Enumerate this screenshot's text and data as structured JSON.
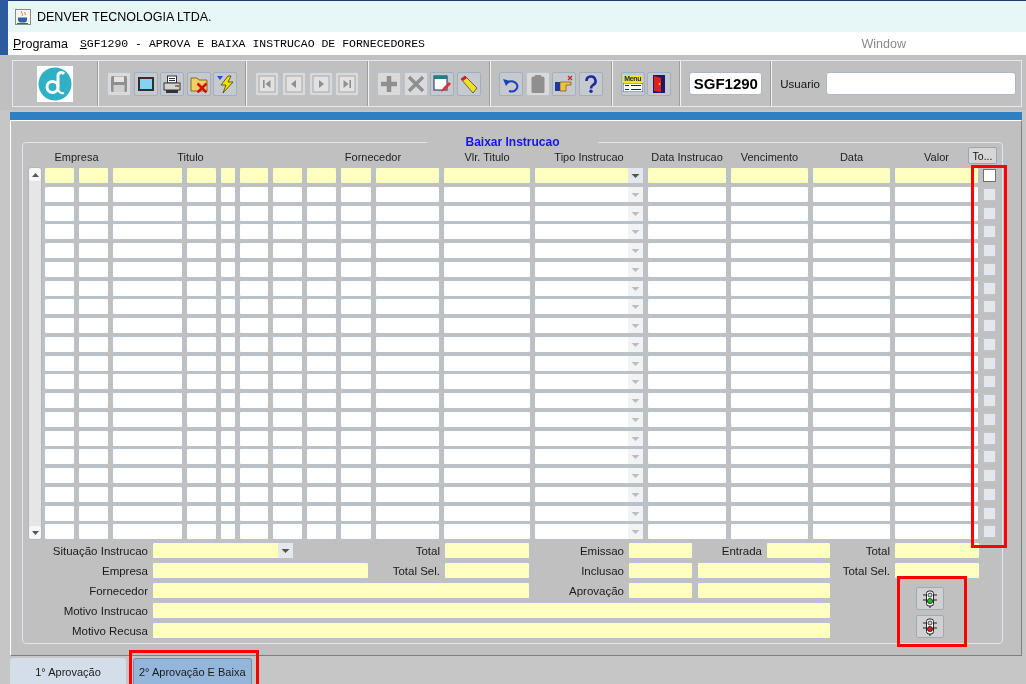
{
  "window": {
    "title": "DENVER TECNOLOGIA LTDA."
  },
  "menu_bar": [
    {
      "label": "Programa",
      "kind": "menu",
      "disabled": false
    },
    {
      "label": "SGF1290 - APROVA E BAIXA INSTRUCAO DE FORNECEDORES",
      "kind": "program",
      "disabled": false
    },
    {
      "label": "Window",
      "kind": "window",
      "disabled": true
    }
  ],
  "toolbar": {
    "groups": [
      {
        "buttons": [
          {
            "kind": "save",
            "disabled": true
          },
          {
            "kind": "screen",
            "disabled": false
          },
          {
            "kind": "print",
            "disabled": false
          },
          {
            "kind": "clear",
            "disabled": false
          },
          {
            "kind": "execute",
            "disabled": false
          }
        ]
      },
      {
        "buttons": [
          {
            "kind": "first",
            "disabled": true
          },
          {
            "kind": "previous",
            "disabled": true
          },
          {
            "kind": "next",
            "disabled": true
          },
          {
            "kind": "last",
            "disabled": true
          }
        ]
      },
      {
        "buttons": [
          {
            "kind": "add",
            "disabled": true
          },
          {
            "kind": "remove",
            "disabled": true
          },
          {
            "kind": "edit",
            "disabled": false
          },
          {
            "kind": "marker",
            "disabled": false
          }
        ]
      },
      {
        "buttons": [
          {
            "kind": "undo",
            "disabled": false
          },
          {
            "kind": "clipboard",
            "disabled": true
          },
          {
            "kind": "hand",
            "disabled": false
          },
          {
            "kind": "help",
            "disabled": false
          }
        ]
      },
      {
        "buttons": [
          {
            "kind": "menu",
            "label": "Menu",
            "disabled": false
          },
          {
            "kind": "exit",
            "disabled": false
          }
        ]
      }
    ],
    "program_code": "SGF1290",
    "user_label": "Usuario"
  },
  "table": {
    "title": "Baixar Instrucao",
    "columns": [
      "Empresa",
      "Titulo",
      "Fornecedor",
      "Vlr. Titulo",
      "Tipo Instrucao",
      "Data Instrucao",
      "Vencimento",
      "Data",
      "Valor"
    ],
    "header_button": "To...",
    "rows": [
      {
        "selected": true,
        "checked": false
      },
      {
        "selected": false,
        "checked": false
      },
      {
        "selected": false,
        "checked": false
      },
      {
        "selected": false,
        "checked": false
      },
      {
        "selected": false,
        "checked": false
      },
      {
        "selected": false,
        "checked": false
      },
      {
        "selected": false,
        "checked": false
      },
      {
        "selected": false,
        "checked": false
      },
      {
        "selected": false,
        "checked": false
      },
      {
        "selected": false,
        "checked": false
      },
      {
        "selected": false,
        "checked": false
      },
      {
        "selected": false,
        "checked": false
      },
      {
        "selected": false,
        "checked": false
      },
      {
        "selected": false,
        "checked": false
      },
      {
        "selected": false,
        "checked": false
      },
      {
        "selected": false,
        "checked": false
      },
      {
        "selected": false,
        "checked": false
      },
      {
        "selected": false,
        "checked": false
      },
      {
        "selected": false,
        "checked": false
      },
      {
        "selected": false,
        "checked": false
      }
    ]
  },
  "form": {
    "rows": [
      {
        "items": [
          {
            "label": "Situação Instrucao",
            "kind": "dropdown"
          },
          {
            "label": "Total",
            "kind": "text"
          },
          {
            "label": "Emissao",
            "kind": "text"
          },
          {
            "label": "Entrada",
            "kind": "text"
          },
          {
            "label": "Total",
            "kind": "text"
          }
        ]
      },
      {
        "items": [
          {
            "label": "Empresa",
            "kind": "text"
          },
          {
            "label": "Total Sel.",
            "kind": "text"
          },
          {
            "label": "Inclusao",
            "kind": "pair"
          },
          {
            "label": "Total Sel.",
            "kind": "text"
          }
        ]
      },
      {
        "items": [
          {
            "label": "Fornecedor",
            "kind": "text"
          },
          {
            "label": "Aprovação",
            "kind": "pair"
          }
        ]
      },
      {
        "items": [
          {
            "label": "Motivo Instrucao",
            "kind": "text"
          }
        ]
      },
      {
        "items": [
          {
            "label": "Motivo Recusa",
            "kind": "text"
          }
        ]
      }
    ],
    "signal_buttons": [
      {
        "kind": "green"
      },
      {
        "kind": "red"
      }
    ]
  },
  "tabs": [
    {
      "label": "1° Aprovação",
      "selected": false
    },
    {
      "label": "2° Aprovação E Baixa",
      "selected": true
    }
  ]
}
